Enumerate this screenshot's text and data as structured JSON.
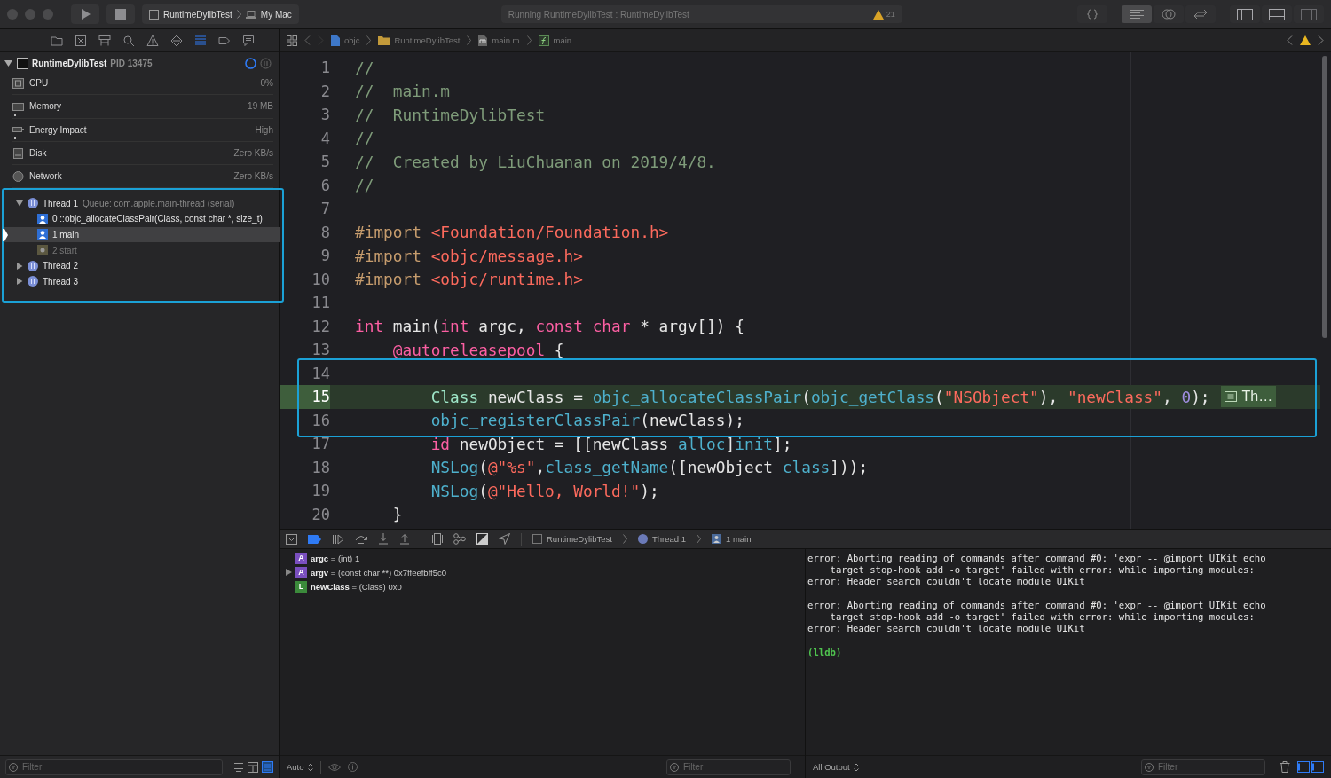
{
  "toolbar": {
    "scheme": "RuntimeDylibTest",
    "destination": "My Mac",
    "activity": "Running RuntimeDylibTest : RuntimeDylibTest",
    "warning_count": "21",
    "editor_modes": [
      {
        "kind": "standard",
        "selected": true
      },
      {
        "kind": "assistant",
        "selected": false
      },
      {
        "kind": "version",
        "selected": false
      }
    ],
    "panels": [
      {
        "kind": "navigator",
        "on": true
      },
      {
        "kind": "debug-area",
        "on": true
      },
      {
        "kind": "inspector",
        "on": false
      }
    ]
  },
  "navigator": {
    "tabs": [
      {
        "kind": "project",
        "selected": false
      },
      {
        "kind": "source-control",
        "selected": false
      },
      {
        "kind": "symbol",
        "selected": false
      },
      {
        "kind": "find",
        "selected": false
      },
      {
        "kind": "issue",
        "selected": false
      },
      {
        "kind": "test",
        "selected": false
      },
      {
        "kind": "debug",
        "selected": true
      },
      {
        "kind": "breakpoint",
        "selected": false
      },
      {
        "kind": "report",
        "selected": false
      }
    ]
  },
  "process": {
    "name": "RuntimeDylibTest",
    "pid": "PID 13475",
    "expanded": true,
    "gauges": [
      {
        "kind": "cpu",
        "label": "CPU",
        "value": "0%"
      },
      {
        "kind": "memory",
        "label": "Memory",
        "value": "19 MB"
      },
      {
        "kind": "energy",
        "label": "Energy Impact",
        "value": "High"
      },
      {
        "kind": "disk",
        "label": "Disk",
        "value": "Zero KB/s"
      },
      {
        "kind": "network",
        "label": "Network",
        "value": "Zero KB/s"
      }
    ],
    "threads_outlined": true,
    "threads": [
      {
        "name": "Thread 1",
        "queue": "Queue: com.apple.main-thread (serial)",
        "expanded": true,
        "frames": [
          {
            "kind": "user",
            "label": "0 ::objc_allocateClassPair(Class, const char *, size_t)",
            "selected": false
          },
          {
            "kind": "user",
            "label": "1 main",
            "selected": true
          },
          {
            "kind": "system",
            "label": "2 start",
            "selected": false
          }
        ]
      },
      {
        "name": "Thread 2",
        "expanded": false
      },
      {
        "name": "Thread 3",
        "expanded": false
      }
    ]
  },
  "navigator_filter": {
    "placeholder": "Filter"
  },
  "jump_bar": {
    "path": [
      {
        "kind": "file",
        "label": "objc"
      },
      {
        "kind": "folder",
        "label": "RuntimeDylibTest"
      },
      {
        "kind": "source",
        "label": "main.m"
      },
      {
        "kind": "function",
        "label": "main"
      }
    ]
  },
  "code": {
    "blocks": [
      {
        "outlined": false,
        "lines": [
          {
            "number": "1",
            "tokens": [
              {
                "kind": "comment",
                "text": "//"
              }
            ]
          },
          {
            "number": "2",
            "tokens": [
              {
                "kind": "comment",
                "text": "//  main.m"
              }
            ]
          },
          {
            "number": "3",
            "tokens": [
              {
                "kind": "comment",
                "text": "//  RuntimeDylibTest"
              }
            ]
          },
          {
            "number": "4",
            "tokens": [
              {
                "kind": "comment",
                "text": "//"
              }
            ]
          },
          {
            "number": "5",
            "tokens": [
              {
                "kind": "comment",
                "text": "//  Created by LiuChuanan on 2019/4/8."
              }
            ]
          },
          {
            "number": "6",
            "tokens": [
              {
                "kind": "comment",
                "text": "//"
              }
            ]
          },
          {
            "number": "7"
          },
          {
            "number": "8",
            "tokens": [
              {
                "kind": "directive",
                "text": "#import "
              },
              {
                "kind": "path",
                "text": "<Foundation/Foundation.h>"
              }
            ]
          },
          {
            "number": "9",
            "tokens": [
              {
                "kind": "directive",
                "text": "#import "
              },
              {
                "kind": "path",
                "text": "<objc/message.h>"
              }
            ]
          },
          {
            "number": "10",
            "tokens": [
              {
                "kind": "directive",
                "text": "#import "
              },
              {
                "kind": "path",
                "text": "<objc/runtime.h>"
              }
            ]
          },
          {
            "number": "11"
          },
          {
            "number": "12",
            "tokens": [
              {
                "kind": "keyword",
                "text": "int"
              },
              {
                "kind": "plain",
                "text": " main("
              },
              {
                "kind": "keyword",
                "text": "int"
              },
              {
                "kind": "plain",
                "text": " argc, "
              },
              {
                "kind": "keyword",
                "text": "const "
              },
              {
                "kind": "keyword",
                "text": "char"
              },
              {
                "kind": "plain",
                "text": " * argv[]) {"
              }
            ]
          },
          {
            "number": "13",
            "tokens": [
              {
                "kind": "keyword",
                "text": "    @autoreleasepool"
              },
              {
                "kind": "plain",
                "text": " {"
              }
            ]
          }
        ]
      },
      {
        "outlined": true,
        "lines": [
          {
            "number": "14"
          },
          {
            "number": "15",
            "current": true,
            "annotation": "Th…",
            "tokens": [
              {
                "kind": "type",
                "text": "        Class"
              },
              {
                "kind": "plain",
                "text": " newClass = "
              },
              {
                "kind": "func",
                "text": "objc_allocateClassPair"
              },
              {
                "kind": "plain",
                "text": "("
              },
              {
                "kind": "func",
                "text": "objc_getClass"
              },
              {
                "kind": "plain",
                "text": "("
              },
              {
                "kind": "string",
                "text": "\"NSObject\""
              },
              {
                "kind": "plain",
                "text": "), "
              },
              {
                "kind": "string",
                "text": "\"newClass\""
              },
              {
                "kind": "plain",
                "text": ", "
              },
              {
                "kind": "number",
                "text": "0"
              },
              {
                "kind": "plain",
                "text": ");"
              }
            ]
          },
          {
            "number": "16",
            "tokens": [
              {
                "kind": "func",
                "text": "        objc_registerClassPair"
              },
              {
                "kind": "plain",
                "text": "(newClass);"
              }
            ]
          }
        ]
      },
      {
        "outlined": false,
        "lines": [
          {
            "number": "17",
            "tokens": [
              {
                "kind": "keyword",
                "text": "        id"
              },
              {
                "kind": "plain",
                "text": " newObject = [[newClass "
              },
              {
                "kind": "func",
                "text": "alloc"
              },
              {
                "kind": "plain",
                "text": "]"
              },
              {
                "kind": "func",
                "text": "init"
              },
              {
                "kind": "plain",
                "text": "];"
              }
            ]
          },
          {
            "number": "18",
            "tokens": [
              {
                "kind": "func",
                "text": "        NSLog"
              },
              {
                "kind": "plain",
                "text": "("
              },
              {
                "kind": "string",
                "text": "@\"%s\""
              },
              {
                "kind": "plain",
                "text": ","
              },
              {
                "kind": "func",
                "text": "class_getName"
              },
              {
                "kind": "plain",
                "text": "([newObject "
              },
              {
                "kind": "func",
                "text": "class"
              },
              {
                "kind": "plain",
                "text": "]));"
              }
            ]
          },
          {
            "number": "19",
            "tokens": [
              {
                "kind": "func",
                "text": "        NSLog"
              },
              {
                "kind": "plain",
                "text": "("
              },
              {
                "kind": "string",
                "text": "@\"Hello, World!\""
              },
              {
                "kind": "plain",
                "text": ");"
              }
            ]
          },
          {
            "number": "20",
            "tokens": [
              {
                "kind": "plain",
                "text": "    }"
              }
            ]
          }
        ]
      }
    ]
  },
  "debug_bar": {
    "breakpoints_active": true,
    "path": [
      {
        "kind": "app",
        "label": "RuntimeDylibTest"
      },
      {
        "kind": "thread",
        "label": "Thread 1"
      },
      {
        "kind": "frame",
        "label": "1 main"
      }
    ]
  },
  "variables": [
    {
      "kind": "argument",
      "badge": "A",
      "name": "argc",
      "value": "= (int) 1",
      "expandable": false
    },
    {
      "kind": "argument",
      "badge": "A",
      "name": "argv",
      "value": "= (const char **) 0x7ffeefbff5c0",
      "expandable": true
    },
    {
      "kind": "local",
      "badge": "L",
      "name": "newClass",
      "value": "= (Class) 0x0",
      "expandable": false
    }
  ],
  "console": {
    "messages": [
      "error: Aborting reading of commands after command #0: 'expr -- @import UIKit echo\n    target stop-hook add -o target' failed with error: while importing modules:\nerror: Header search couldn't locate module UIKit",
      "error: Aborting reading of commands after command #0: 'expr -- @import UIKit echo\n    target stop-hook add -o target' failed with error: while importing modules:\nerror: Header search couldn't locate module UIKit"
    ],
    "prompt": "(lldb)"
  },
  "variables_bar": {
    "scope": "Auto",
    "filter_placeholder": "Filter"
  },
  "console_bar": {
    "output": "All Output",
    "filter_placeholder": "Filter"
  }
}
